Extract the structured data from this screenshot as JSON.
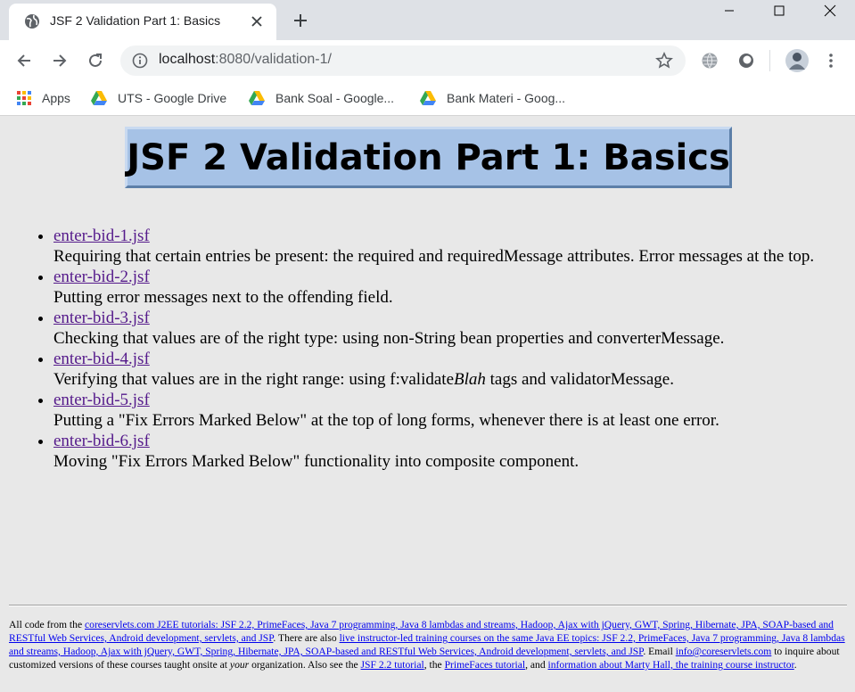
{
  "browser": {
    "tab_title": "JSF 2 Validation Part 1: Basics",
    "url_host": "localhost",
    "url_rest": ":8080/validation-1/",
    "bookmarks": [
      {
        "label": "Apps",
        "icon": "apps-grid-icon"
      },
      {
        "label": "UTS - Google Drive",
        "icon": "google-drive-icon"
      },
      {
        "label": "Bank Soal - Google...",
        "icon": "google-drive-icon"
      },
      {
        "label": "Bank Materi - Goog...",
        "icon": "google-drive-icon"
      }
    ],
    "colors": {
      "tabstrip": "#dee1e6",
      "toolbar": "#ffffff",
      "omnibox": "#f1f3f4"
    }
  },
  "page": {
    "heading": "JSF 2 Validation Part 1: Basics",
    "items": [
      {
        "link": "enter-bid-1.jsf",
        "desc": "Requiring that certain entries be present: the required and requiredMessage attributes. Error messages at the top."
      },
      {
        "link": "enter-bid-2.jsf",
        "desc": "Putting error messages next to the offending field."
      },
      {
        "link": "enter-bid-3.jsf",
        "desc": "Checking that values are of the right type: using non-String bean properties and converterMessage."
      },
      {
        "link": "enter-bid-4.jsf",
        "desc_pre": "Verifying that values are in the right range: using f:validate",
        "desc_em": "Blah",
        "desc_post": " tags and validatorMessage."
      },
      {
        "link": "enter-bid-5.jsf",
        "desc": "Putting a \"Fix Errors Marked Below\" at the top of long forms, whenever there is at least one error."
      },
      {
        "link": "enter-bid-6.jsf",
        "desc": "Moving \"Fix Errors Marked Below\" functionality into composite component."
      }
    ],
    "colors": {
      "background": "#e8e8e8",
      "title_box": "#a6c2e6",
      "visited_link": "#551a8b",
      "link": "#0000ee"
    }
  },
  "footer": {
    "t1": "All code from the ",
    "l1": "coreservlets.com J2EE tutorials: JSF 2.2, PrimeFaces, Java 7 programming, Java 8 lambdas and streams, Hadoop, Ajax with jQuery, GWT, Spring, Hibernate, JPA, SOAP-based and RESTful Web Services, Android development, servlets, and JSP",
    "t2": ". There are also ",
    "l2": "live instructor-led training courses on the same Java EE topics: JSF 2.2, PrimeFaces, Java 7 programming, Java 8 lambdas and streams, Hadoop, Ajax with jQuery, GWT, Spring, Hibernate, JPA, SOAP-based and RESTful Web Services, Android development, servlets, and JSP",
    "t3": ". Email ",
    "l3": "info@coreservlets.com",
    "t4": " to inquire about customized versions of these courses taught onsite at ",
    "t4em": "your",
    "t5": " organization. Also see the ",
    "l4": "JSF 2.2 tutorial",
    "t6": ", the ",
    "l5": "PrimeFaces tutorial",
    "t7": ", and ",
    "l6": "information about Marty Hall, the training course instructor",
    "t8": "."
  }
}
